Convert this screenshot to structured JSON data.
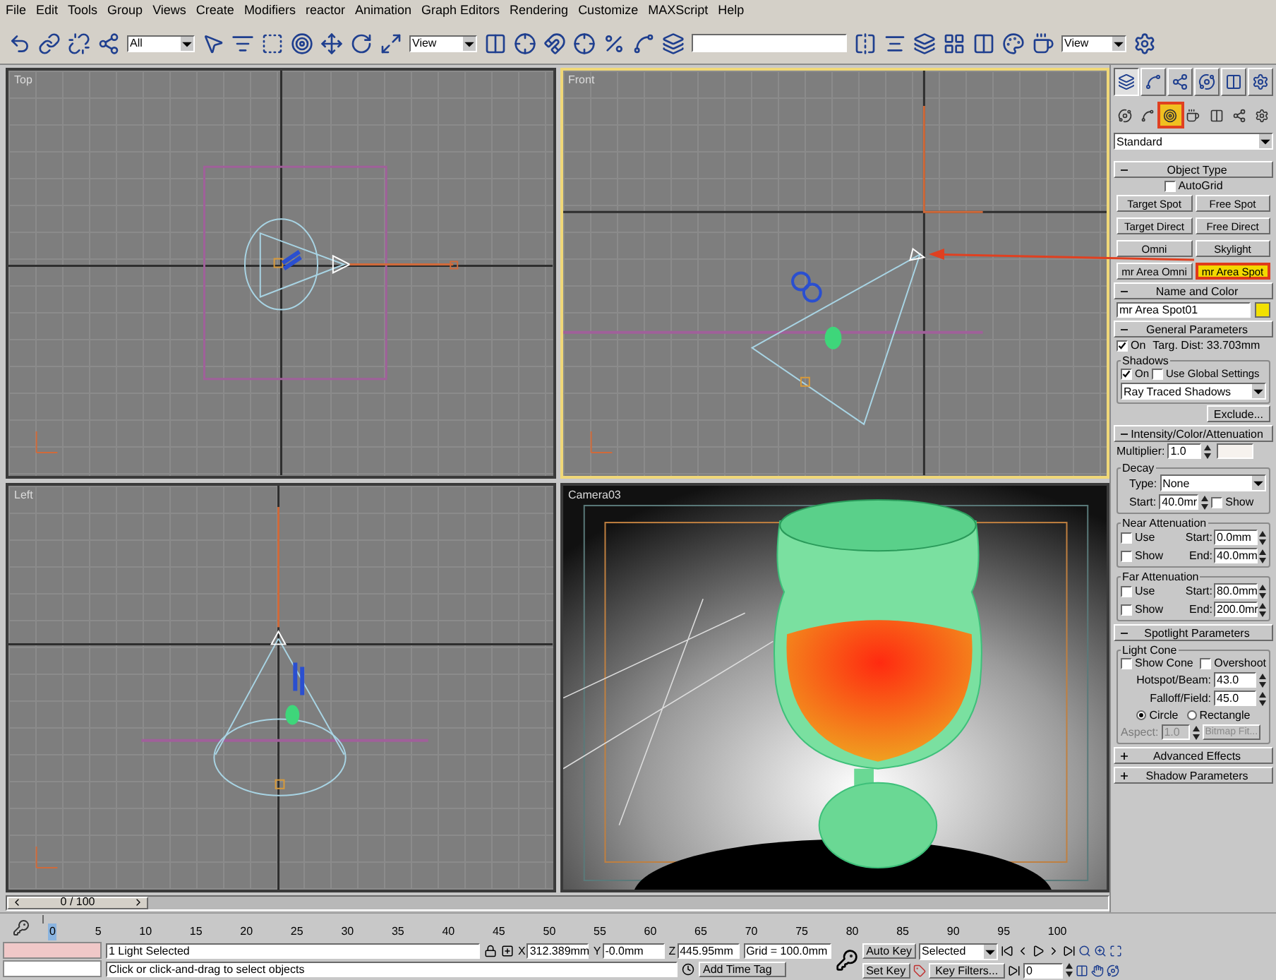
{
  "menu": [
    "File",
    "Edit",
    "Tools",
    "Group",
    "Views",
    "Create",
    "Modifiers",
    "reactor",
    "Animation",
    "Graph Editors",
    "Rendering",
    "Customize",
    "MAXScript",
    "Help"
  ],
  "toolbar": {
    "selection_filter": "All",
    "reference_coordinate": "View",
    "render_view": "View"
  },
  "viewports": [
    {
      "label": "Top",
      "kind": "top",
      "active": false
    },
    {
      "label": "Front",
      "kind": "front",
      "active": true
    },
    {
      "label": "Left",
      "kind": "left",
      "active": false
    },
    {
      "label": "Camera03",
      "kind": "camera",
      "active": false
    }
  ],
  "command_panel": {
    "tabs": [
      {
        "selected": true
      },
      {
        "selected": false
      },
      {
        "selected": false
      },
      {
        "selected": false
      },
      {
        "selected": false
      },
      {
        "selected": false
      }
    ],
    "categories": [
      {
        "selected": false
      },
      {
        "selected": false
      },
      {
        "selected": true
      },
      {
        "selected": false
      },
      {
        "selected": false
      },
      {
        "selected": false
      },
      {
        "selected": false
      }
    ],
    "object_class": "Standard",
    "object_type": {
      "title": "Object Type",
      "expanded": true,
      "autogrid": {
        "label": "AutoGrid",
        "checked": false
      },
      "buttons": [
        {
          "label": "Target Spot",
          "selected": false
        },
        {
          "label": "Free Spot",
          "selected": false
        },
        {
          "label": "Target Direct",
          "selected": false
        },
        {
          "label": "Free Direct",
          "selected": false
        },
        {
          "label": "Omni",
          "selected": false
        },
        {
          "label": "Skylight",
          "selected": false
        },
        {
          "label": "mr Area Omni",
          "selected": false
        },
        {
          "label": "mr Area Spot",
          "selected": true
        }
      ]
    },
    "name_and_color": {
      "title": "Name and Color",
      "expanded": true,
      "name": "mr Area Spot01",
      "color": "#f2e000"
    },
    "general_parameters": {
      "title": "General Parameters",
      "expanded": true,
      "light_on": {
        "label": "On",
        "checked": true
      },
      "target_distance": "Targ. Dist: 33.703mm",
      "shadows_group": "Shadows",
      "shadows_on": {
        "label": "On",
        "checked": true
      },
      "use_global": {
        "label": "Use Global Settings",
        "checked": false
      },
      "shadow_type": "Ray Traced Shadows",
      "exclude": "Exclude..."
    },
    "intensity": {
      "title": "Intensity/Color/Attenuation",
      "expanded": true,
      "multiplier_label": "Multiplier:",
      "multiplier": "1.0",
      "color": "#f6f2ee",
      "decay": {
        "group": "Decay",
        "type_label": "Type:",
        "type": "None",
        "start_label": "Start:",
        "start": "40.0mr",
        "show": {
          "label": "Show",
          "checked": false
        }
      },
      "near": {
        "group": "Near Attenuation",
        "use": {
          "label": "Use",
          "checked": false
        },
        "show": {
          "label": "Show",
          "checked": false
        },
        "start_label": "Start:",
        "start": "0.0mm",
        "end_label": "End:",
        "end": "40.0mm"
      },
      "far": {
        "group": "Far Attenuation",
        "use": {
          "label": "Use",
          "checked": false
        },
        "show": {
          "label": "Show",
          "checked": false
        },
        "start_label": "Start:",
        "start": "80.0mm",
        "end_label": "End:",
        "end": "200.0mr"
      }
    },
    "spotlight": {
      "title": "Spotlight Parameters",
      "expanded": true,
      "group": "Light Cone",
      "show_cone": {
        "label": "Show Cone",
        "checked": false
      },
      "overshoot": {
        "label": "Overshoot",
        "checked": false
      },
      "hotspot_label": "Hotspot/Beam:",
      "hotspot": "43.0",
      "falloff_label": "Falloff/Field:",
      "falloff": "45.0",
      "shape": [
        {
          "label": "Circle",
          "selected": true
        },
        {
          "label": "Rectangle",
          "selected": false
        }
      ],
      "aspect_label": "Aspect:",
      "aspect": "1.0",
      "aspect_disabled": true,
      "bitmap_fit": "Bitmap Fit..."
    },
    "collapsed_rollouts": [
      {
        "title": "Advanced Effects",
        "expanded": false
      },
      {
        "title": "Shadow Parameters",
        "expanded": false
      }
    ]
  },
  "timeline": {
    "position": "0 / 100"
  },
  "ruler": {
    "labels": [
      "0",
      "5",
      "10",
      "15",
      "20",
      "25",
      "30",
      "35",
      "40",
      "45",
      "50",
      "55",
      "60",
      "65",
      "70",
      "75",
      "80",
      "85",
      "90",
      "95",
      "100"
    ]
  },
  "status": {
    "selection": "1 Light Selected",
    "prompt": "Click or click-and-drag to select objects",
    "x_label": "X",
    "x": "312.389mm",
    "y_label": "Y",
    "y": "-0.0mm",
    "z_label": "Z",
    "z": "445.95mm",
    "grid": "Grid = 100.0mm",
    "add_time_tag": "Add Time Tag",
    "auto_key": "Auto Key",
    "key_mode": "Selected",
    "set_key": "Set Key",
    "key_filters": "Key Filters...",
    "frame": "0"
  }
}
